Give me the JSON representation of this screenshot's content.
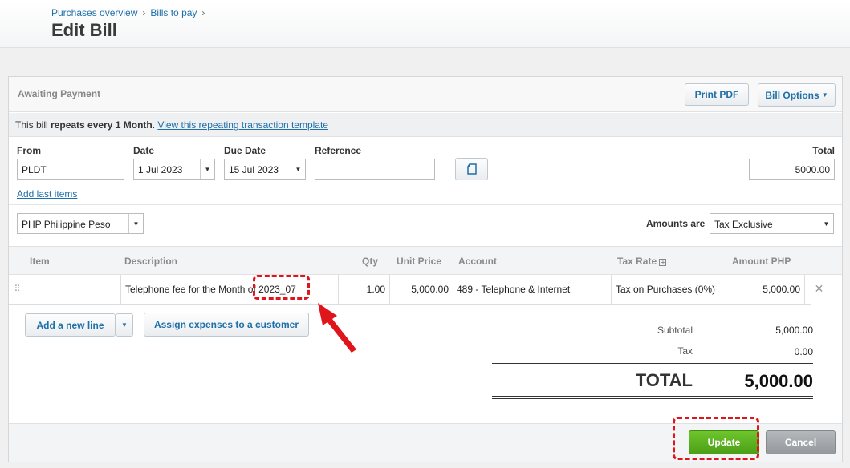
{
  "breadcrumb": {
    "items": [
      "Purchases overview",
      "Bills to pay"
    ],
    "sep": "›"
  },
  "page_title": "Edit Bill",
  "status": "Awaiting Payment",
  "buttons": {
    "print_pdf": "Print PDF",
    "bill_options": "Bill Options",
    "add_new_line": "Add a new line",
    "assign_expenses": "Assign expenses to a customer",
    "update": "Update",
    "cancel": "Cancel"
  },
  "repeat": {
    "prefix": "This bill ",
    "bold1": "repeats every 1 Month",
    "mid": ". ",
    "link": "View this repeating transaction template"
  },
  "form": {
    "from_label": "From",
    "from_value": "PLDT",
    "date_label": "Date",
    "date_value": "1 Jul 2023",
    "due_label": "Due Date",
    "due_value": "15 Jul 2023",
    "ref_label": "Reference",
    "ref_value": "",
    "total_label": "Total",
    "total_value": "5000.00",
    "add_last_items": "Add last items",
    "currency": "PHP Philippine Peso",
    "amounts_are_label": "Amounts are",
    "amounts_are_value": "Tax Exclusive"
  },
  "table": {
    "headers": {
      "item": "Item",
      "description": "Description",
      "qty": "Qty",
      "unit_price": "Unit Price",
      "account": "Account",
      "tax_rate": "Tax Rate",
      "amount": "Amount PHP"
    },
    "rows": [
      {
        "item": "",
        "description": "Telephone fee for the Month of 2023_07",
        "qty": "1.00",
        "unit_price": "5,000.00",
        "account": "489 - Telephone & Internet",
        "tax_rate": "Tax on Purchases (0%)",
        "amount": "5,000.00"
      }
    ]
  },
  "totals": {
    "subtotal_label": "Subtotal",
    "subtotal_value": "5,000.00",
    "tax_label": "Tax",
    "tax_value": "0.00",
    "total_label": "TOTAL",
    "total_value": "5,000.00"
  },
  "colors": {
    "accent_link": "#1f6fa8",
    "update_green": "#5aaf1e",
    "annotation_red": "#e0141b"
  },
  "icons": {
    "dropdown": "▼",
    "plus_box": "⊞",
    "drag": "⠿",
    "remove": "✕",
    "copy": "copy-icon"
  }
}
